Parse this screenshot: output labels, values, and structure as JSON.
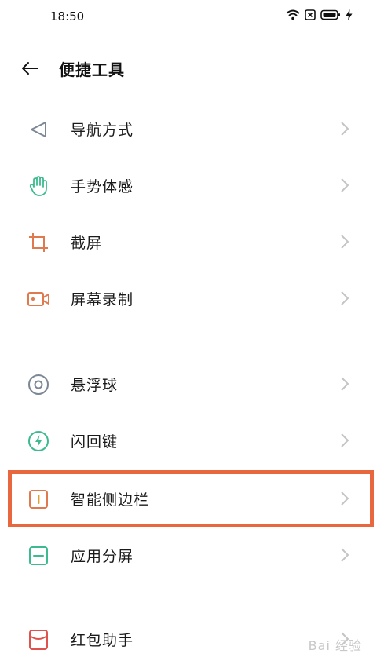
{
  "status_bar": {
    "time": "18:50"
  },
  "header": {
    "title": "便捷工具"
  },
  "items": [
    {
      "label": "导航方式",
      "icon": "navigation-arrow-icon"
    },
    {
      "label": "手势体感",
      "icon": "hand-gesture-icon"
    },
    {
      "label": "截屏",
      "icon": "crop-screenshot-icon"
    },
    {
      "label": "屏幕录制",
      "icon": "screen-record-icon"
    },
    {
      "label": "悬浮球",
      "icon": "floating-ball-icon"
    },
    {
      "label": "闪回键",
      "icon": "flash-back-icon"
    },
    {
      "label": "智能侧边栏",
      "icon": "smart-sidebar-icon"
    },
    {
      "label": "应用分屏",
      "icon": "split-screen-icon"
    },
    {
      "label": "红包助手",
      "icon": "red-envelope-icon"
    }
  ],
  "watermark": "Bai 经验",
  "colors": {
    "highlight": "#e8673f",
    "green": "#3dbb8f",
    "orange": "#e07a4e",
    "gray": "#7b8794"
  }
}
